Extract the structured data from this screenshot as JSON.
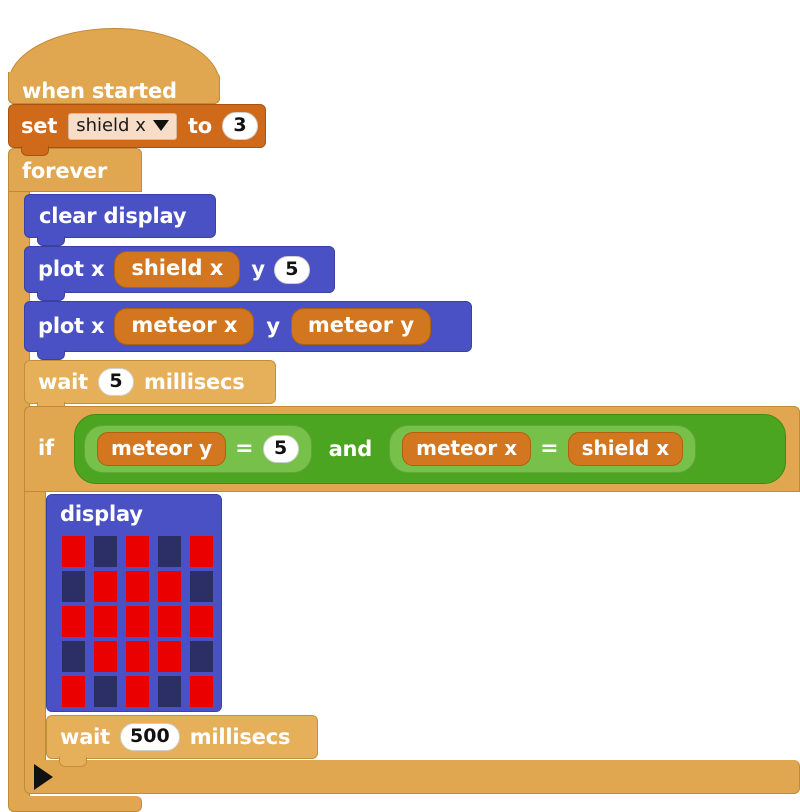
{
  "editor": {
    "name": "block-code-editor",
    "background": "#ffffff",
    "palette": {
      "event_orange": "#e0a650",
      "variable_orange": "#cf6a1a",
      "reporter_orange": "#d2761f",
      "basic_blue": "#4a51c4",
      "control_tan": "#e6b05a",
      "logic_green_dark": "#4ca520",
      "logic_green_light": "#77c04a",
      "led_on": "#ea0000",
      "led_off": "#2b2f66",
      "dropdown_bg": "#f7ddc8",
      "field_white": "#ffffff"
    }
  },
  "script": {
    "hat": {
      "label": "when started"
    },
    "set_block": {
      "keyword": "set",
      "variable": "shield x",
      "to_label": "to",
      "value": "3",
      "dropdown_icon": "chevron-down-icon"
    },
    "forever_block": {
      "label": "forever"
    },
    "clear_display": {
      "label": "clear display"
    },
    "plot_1": {
      "keyword": "plot x",
      "x_value": "shield x",
      "y_label": "y",
      "y_value": "5"
    },
    "plot_2": {
      "keyword": "plot x",
      "x_value": "meteor x",
      "y_label": "y",
      "y_value": "meteor y"
    },
    "wait_1": {
      "keyword": "wait",
      "value": "5",
      "unit": "millisecs"
    },
    "if_block": {
      "keyword": "if",
      "condition": {
        "operator": "and",
        "left": {
          "operator": "=",
          "a": "meteor y",
          "b": "5"
        },
        "right": {
          "operator": "=",
          "a": "meteor x",
          "b": "shield x"
        }
      },
      "expander_icon": "play-triangle-icon"
    },
    "display_block": {
      "label": "display",
      "grid": [
        [
          1,
          0,
          1,
          0,
          1
        ],
        [
          0,
          1,
          1,
          1,
          0
        ],
        [
          1,
          1,
          1,
          1,
          1
        ],
        [
          0,
          1,
          1,
          1,
          0
        ],
        [
          1,
          0,
          1,
          0,
          1
        ]
      ]
    },
    "wait_2": {
      "keyword": "wait",
      "value": "500",
      "unit": "millisecs"
    }
  }
}
